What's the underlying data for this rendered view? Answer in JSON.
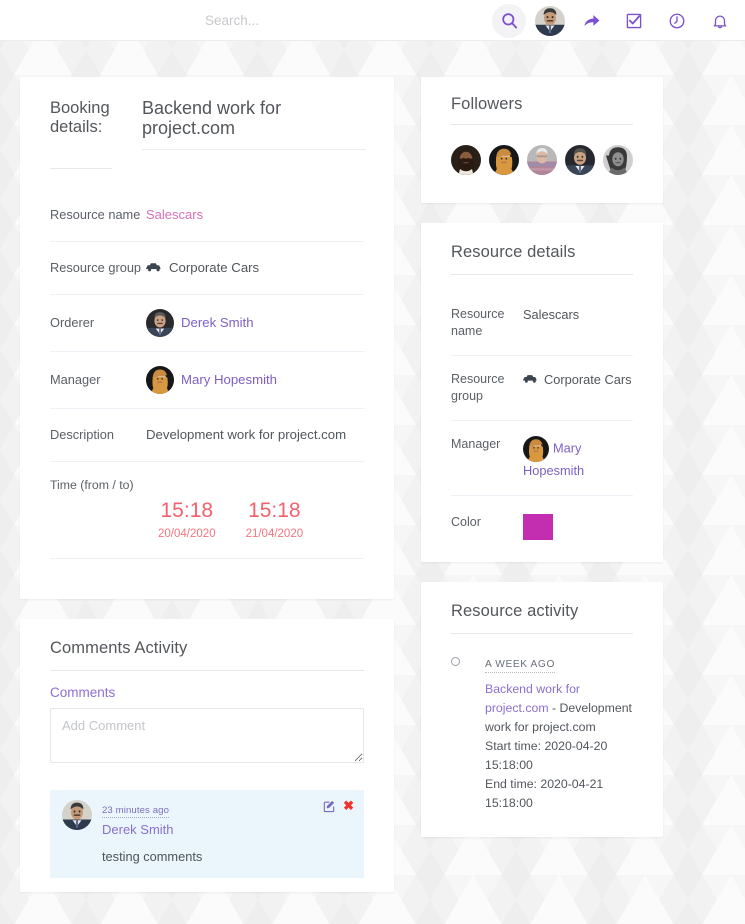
{
  "header": {
    "search_placeholder": "Search...",
    "icons": [
      {
        "name": "search-icon",
        "label": "Search"
      },
      {
        "name": "user-avatar",
        "label": "Account"
      },
      {
        "name": "share-arrow-icon",
        "label": "Share"
      },
      {
        "name": "tasks-checkbox-icon",
        "label": "Tasks"
      },
      {
        "name": "clock-icon",
        "label": "Time"
      },
      {
        "name": "bell-icon",
        "label": "Notifications"
      }
    ]
  },
  "booking_details": {
    "title": "Booking details:",
    "name": "Backend work for project.com",
    "rows": [
      {
        "label": "Resource name",
        "value": "Salescars",
        "kind": "link-pink"
      },
      {
        "label": "Resource group",
        "value": "Corporate Cars",
        "kind": "icon-text",
        "icon": "car-icon"
      },
      {
        "label": "Orderer",
        "value": "Derek Smith",
        "kind": "avatar-link"
      },
      {
        "label": "Manager",
        "value": "Mary Hopesmith",
        "kind": "avatar-link"
      },
      {
        "label": "Description",
        "value": "Development work for project.com",
        "kind": "text"
      }
    ],
    "time": {
      "label": "Time (from / to)",
      "from_time": "15:18",
      "from_date": "20/04/2020",
      "to_time": "15:18",
      "to_date": "21/04/2020",
      "color": "#f4606c"
    }
  },
  "followers": {
    "title": "Followers",
    "count": 5,
    "people": [
      "follower-1",
      "follower-2",
      "follower-3",
      "follower-4",
      "follower-5"
    ]
  },
  "resource_details": {
    "title": "Resource details",
    "rows": [
      {
        "label": "Resource name",
        "value": "Salescars"
      },
      {
        "label": "Resource group",
        "value": "Corporate Cars",
        "icon": "car-icon"
      },
      {
        "label": "Manager",
        "value": "Mary Hopesmith",
        "kind": "avatar-link"
      },
      {
        "label": "Color",
        "value": "#c32eb0",
        "kind": "swatch"
      }
    ]
  },
  "resource_activity": {
    "title": "Resource activity",
    "items": [
      {
        "when": "A WEEK AGO",
        "link_text": "Backend work for project.com",
        "separator": " - ",
        "description": "Development work for project.com",
        "start_time": "Start time: 2020-04-20 15:18:00",
        "end_time": "End time: 2020-04-21 15:18:00"
      }
    ]
  },
  "comments_activity": {
    "title": "Comments Activity",
    "section_label": "Comments",
    "input_placeholder": "Add Comment",
    "input_value": "",
    "comments": [
      {
        "time": "23 minutes ago",
        "author": "Derek Smith",
        "text": "testing comments",
        "edit_label": "edit-icon",
        "delete_label": "✖"
      }
    ]
  }
}
